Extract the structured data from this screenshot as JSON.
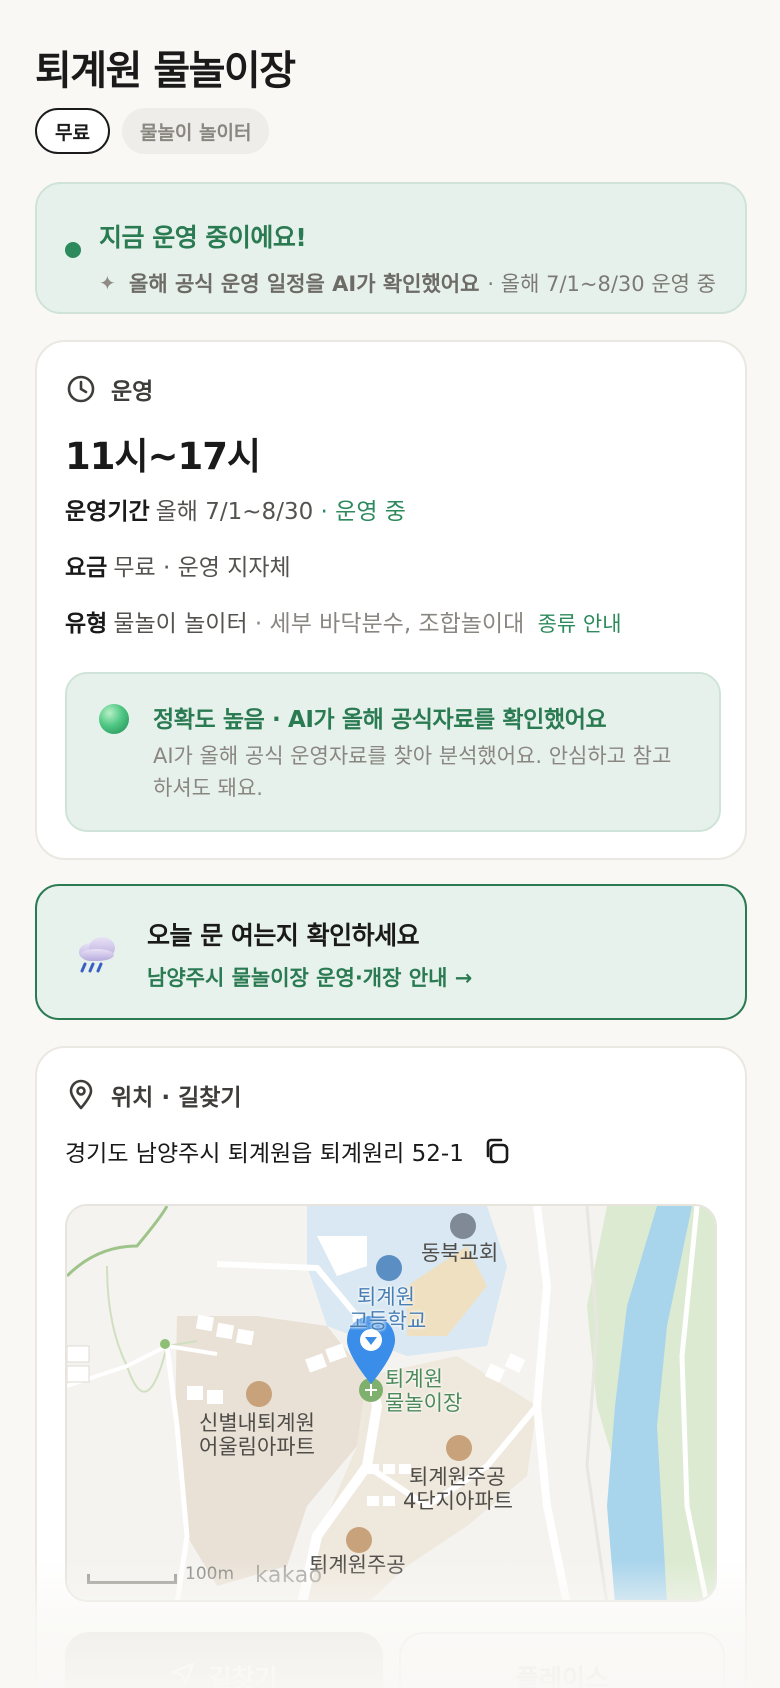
{
  "header": {
    "title": "퇴계원 물놀이장",
    "chips": {
      "price": "무료",
      "type": "물놀이 놀이터"
    }
  },
  "status": {
    "title": "지금 운영 중이에요!",
    "sub_bold": "올해 공식 운영 일정을 AI가 확인했어요",
    "sub_rest": "· 올해 7/1~8/30 운영 중"
  },
  "operation": {
    "section_label": "운영",
    "hours": "11시~17시",
    "period": {
      "label": "운영기간",
      "value": "올해 7/1~8/30",
      "status": "· 운영 중"
    },
    "fee": {
      "label": "요금",
      "value": "무료 · 운영 지자체"
    },
    "kind": {
      "label": "유형",
      "value": "물놀이 놀이터",
      "detail": "· 세부 바닥분수, 조합놀이대",
      "link": "종류 안내"
    },
    "accuracy": {
      "title": "정확도 높음 · AI가 올해 공식자료를 확인했어요",
      "body": "AI가 올해 공식 운영자료를 찾아 분석했어요. 안심하고 참고하셔도 돼요."
    }
  },
  "notice": {
    "title": "오늘 문 여는지 확인하세요",
    "link": "남양주시 물놀이장 운영·개장 안내 →"
  },
  "location": {
    "section_label": "위치 · 길찾기",
    "address": "경기도 남양주시 퇴계원읍 퇴계원리 52-1",
    "map": {
      "labels": {
        "church": "동북교회",
        "school_1": "퇴계원",
        "school_2": "고등학교",
        "target_1": "퇴계원",
        "target_2": "물놀이장",
        "apt1_1": "신별내퇴계원",
        "apt1_2": "어울림아파트",
        "apt2_1": "퇴계원주공",
        "apt2_2": "4단지아파트",
        "apt3": "퇴계원주공"
      },
      "scale": "100m",
      "provider": "kakao"
    },
    "buttons": {
      "route": "길찾기",
      "place": "플레이스"
    }
  },
  "colors": {
    "accent": "#2a7a52",
    "accent_bg": "#e7f1ec",
    "water": "#a8d4ec",
    "park": "#d8e8c8"
  },
  "icons": [
    "sparkle-icon",
    "clock-icon",
    "rain-cloud-icon",
    "pin-icon",
    "copy-icon",
    "map-marker-icon",
    "navigation-icon"
  ]
}
